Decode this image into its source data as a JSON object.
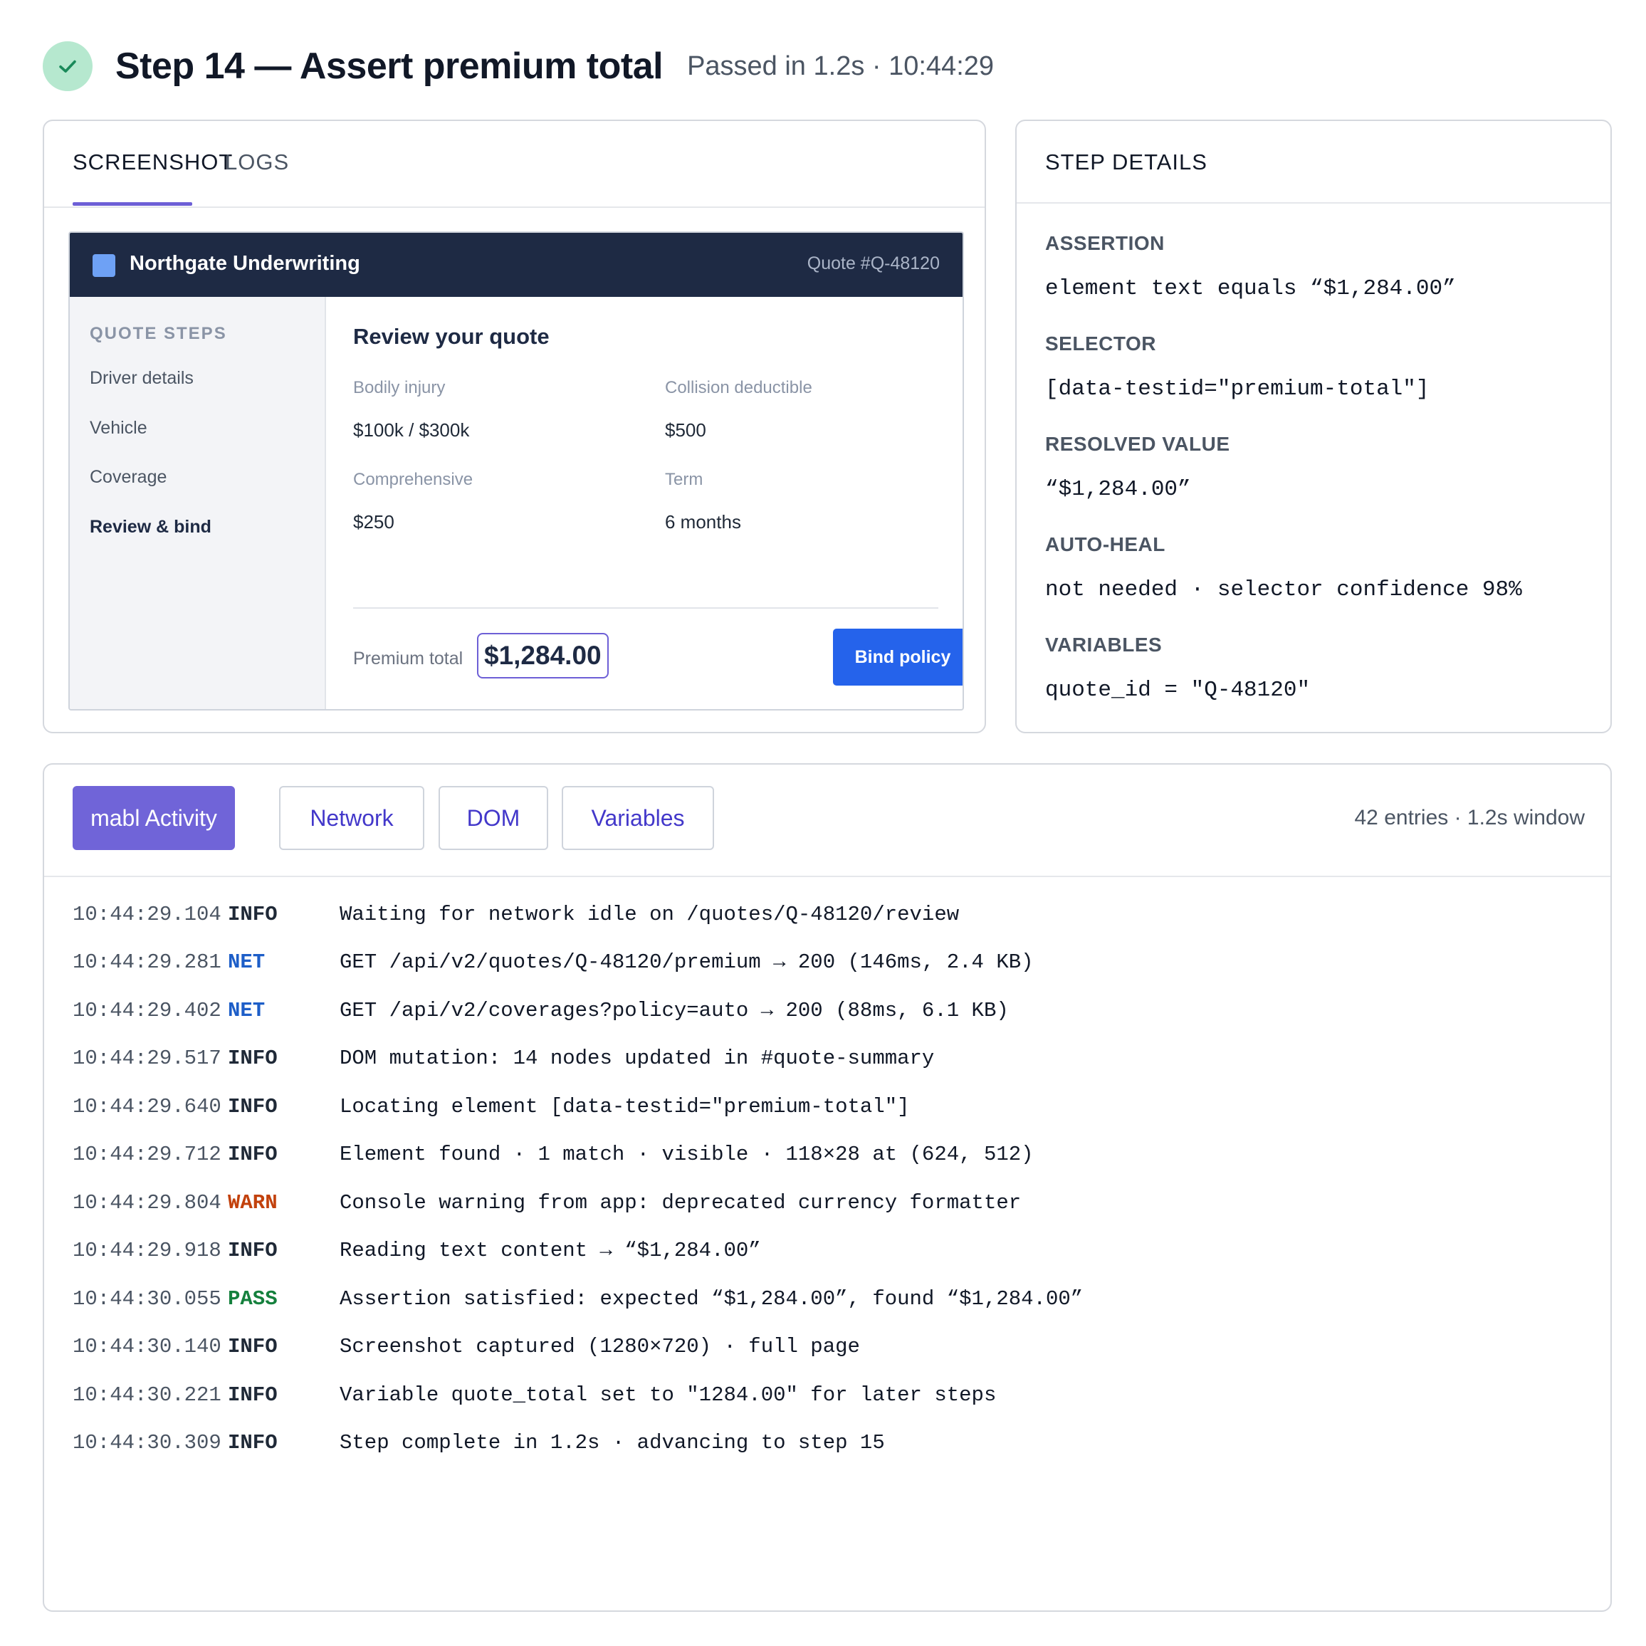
{
  "header": {
    "title": "Step 14 — Assert premium total",
    "meta": "Passed in 1.2s · 10:44:29",
    "status_color": "#b6e8cf"
  },
  "screenshot_panel": {
    "tabs": [
      {
        "label": "SCREENSHOT",
        "active": true
      },
      {
        "label": "LOGS",
        "active": false
      }
    ],
    "app": {
      "brand": "Northgate Underwriting",
      "quote_id": "Quote #Q-48120",
      "sidebar": {
        "heading": "QUOTE STEPS",
        "items": [
          {
            "label": "Driver details"
          },
          {
            "label": "Vehicle"
          },
          {
            "label": "Coverage"
          },
          {
            "label": "Review & bind",
            "active": true
          }
        ]
      },
      "main": {
        "title": "Review your quote",
        "fields": [
          {
            "label": "Bodily injury",
            "value": "$100k / $300k"
          },
          {
            "label": "Collision deductible",
            "value": "$500"
          },
          {
            "label": "Comprehensive",
            "value": "$250"
          },
          {
            "label": "Term",
            "value": "6 months"
          }
        ],
        "premium_label": "Premium total",
        "premium_value": "$1,284.00",
        "bind_button": "Bind policy"
      }
    }
  },
  "step_details": {
    "title": "STEP DETAILS",
    "items": [
      {
        "label": "ASSERTION",
        "value": "element text equals “$1,284.00”"
      },
      {
        "label": "SELECTOR",
        "value": "[data-testid=\"premium-total\"]"
      },
      {
        "label": "RESOLVED VALUE",
        "value": "“$1,284.00”"
      },
      {
        "label": "AUTO-HEAL",
        "value": "not needed · selector confidence 98%"
      },
      {
        "label": "VARIABLES",
        "value": "quote_id = \"Q-48120\""
      }
    ]
  },
  "activity": {
    "tabs": [
      {
        "label": "mabl Activity",
        "active": true
      },
      {
        "label": "Network",
        "active": false
      },
      {
        "label": "DOM",
        "active": false
      },
      {
        "label": "Variables",
        "active": false
      }
    ],
    "summary": "42 entries · 1.2s window",
    "logs": [
      {
        "time": "10:44:29.104",
        "level": "INFO",
        "message": "Waiting for network idle on /quotes/Q-48120/review"
      },
      {
        "time": "10:44:29.281",
        "level": "NET",
        "message": "GET /api/v2/quotes/Q-48120/premium → 200 (146ms, 2.4 KB)"
      },
      {
        "time": "10:44:29.402",
        "level": "NET",
        "message": "GET /api/v2/coverages?policy=auto → 200 (88ms, 6.1 KB)"
      },
      {
        "time": "10:44:29.517",
        "level": "INFO",
        "message": "DOM mutation: 14 nodes updated in #quote-summary"
      },
      {
        "time": "10:44:29.640",
        "level": "INFO",
        "message": "Locating element [data-testid=\"premium-total\"]"
      },
      {
        "time": "10:44:29.712",
        "level": "INFO",
        "message": "Element found · 1 match · visible · 118×28 at (624, 512)"
      },
      {
        "time": "10:44:29.804",
        "level": "WARN",
        "message": "Console warning from app: deprecated currency formatter"
      },
      {
        "time": "10:44:29.918",
        "level": "INFO",
        "message": "Reading text content → “$1,284.00”"
      },
      {
        "time": "10:44:30.055",
        "level": "PASS",
        "message": "Assertion satisfied: expected “$1,284.00”, found “$1,284.00”"
      },
      {
        "time": "10:44:30.140",
        "level": "INFO",
        "message": "Screenshot captured (1280×720) · full page"
      },
      {
        "time": "10:44:30.221",
        "level": "INFO",
        "message": "Variable quote_total set to \"1284.00\" for later steps"
      },
      {
        "time": "10:44:30.309",
        "level": "INFO",
        "message": "Step complete in 1.2s · advancing to step 15"
      }
    ]
  }
}
